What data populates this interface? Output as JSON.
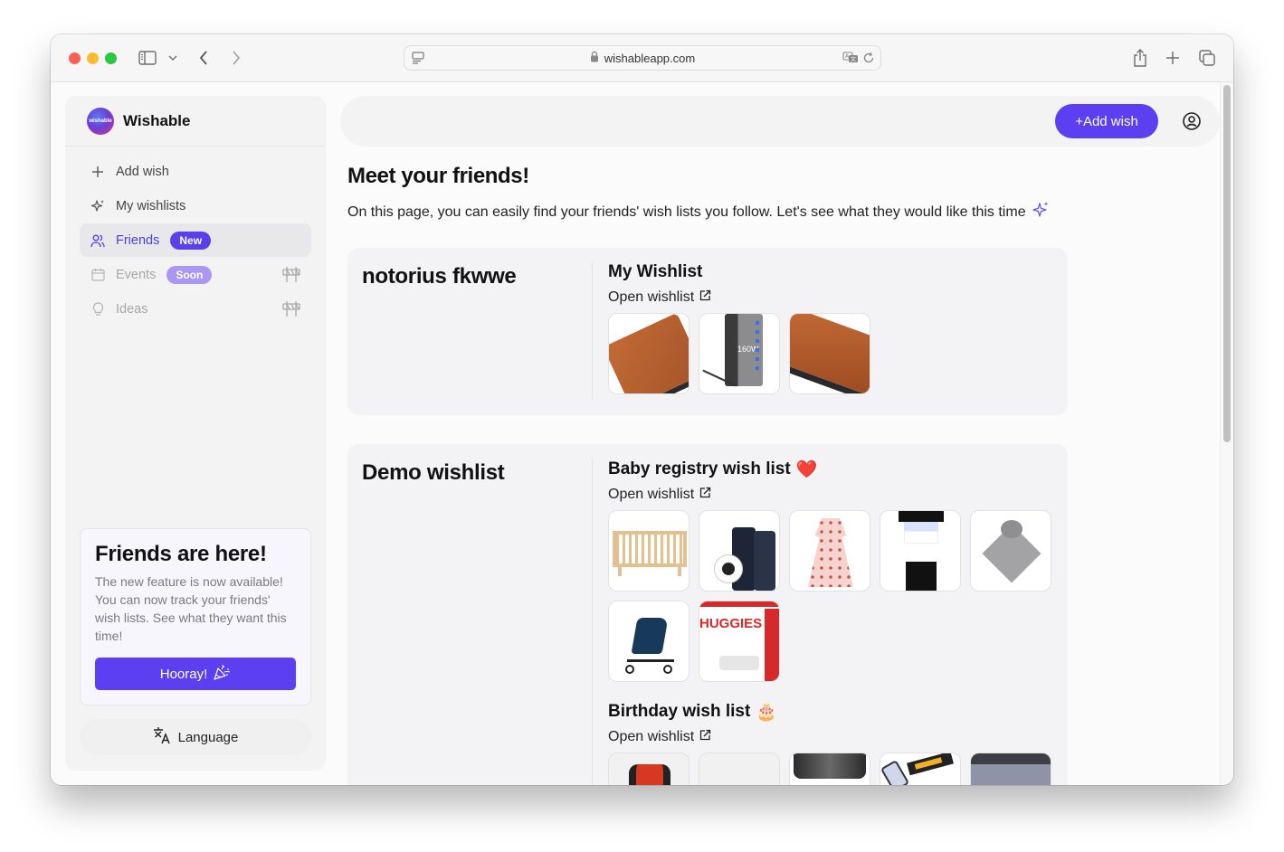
{
  "browser": {
    "url": "wishableapp.com"
  },
  "sidebar": {
    "brand": "Wishable",
    "logo_text": "wishable",
    "items": [
      {
        "label": "Add wish",
        "icon": "plus-icon"
      },
      {
        "label": "My wishlists",
        "icon": "sparkles-icon"
      },
      {
        "label": "Friends",
        "icon": "users-icon",
        "badge": "New",
        "active": true
      },
      {
        "label": "Events",
        "icon": "calendar-icon",
        "badge": "Soon",
        "disabled": true
      },
      {
        "label": "Ideas",
        "icon": "lightbulb-icon",
        "disabled": true
      }
    ],
    "promo": {
      "title": "Friends are here!",
      "text": "The new feature is now available! You can now track your friends' wish lists. See what they want this time!",
      "button": "Hooray!"
    },
    "language_label": "Language"
  },
  "topbar": {
    "add_wish_label": "+Add wish"
  },
  "main": {
    "title": "Meet your friends!",
    "subtitle": "On this page, you can easily find your friends' wish lists you follow. Let's see what they would like this time"
  },
  "friends": [
    {
      "name": "notorius fkwwe",
      "wishlists": [
        {
          "title": "My Wishlist",
          "emoji": "",
          "open_label": "Open wishlist",
          "items": [
            "brown leather wallet",
            "160W USB charger",
            "brown leather wallet"
          ]
        }
      ]
    },
    {
      "name": "Demo wishlist",
      "wishlists": [
        {
          "title": "Baby registry wish list",
          "emoji": "❤️",
          "open_label": "Open wishlist",
          "items": [
            "wooden crib",
            "baby monitor",
            "pink floral dress",
            "black and white outfit",
            "elephant lovey blanket",
            "stroller",
            "Huggies wipes"
          ]
        },
        {
          "title": "Birthday wish list",
          "emoji": "🎂",
          "open_label": "Open wishlist",
          "items": [
            "red jacket",
            "blank item",
            "car phone mount",
            "photo printer",
            "laptop"
          ]
        }
      ]
    }
  ],
  "colors": {
    "accent": "#5b3ff0",
    "badge_soon": "#a997f3"
  }
}
